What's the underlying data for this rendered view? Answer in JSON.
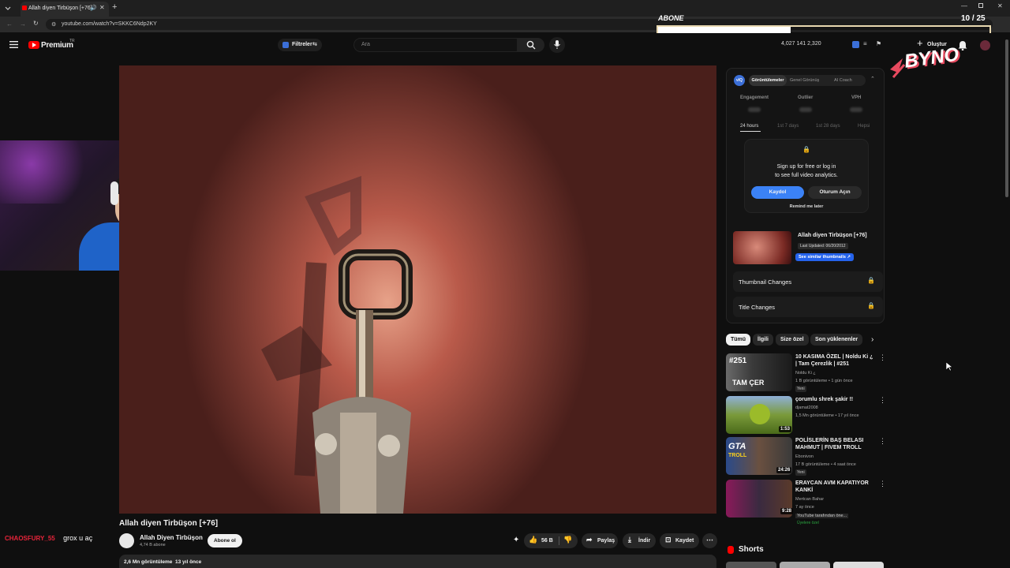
{
  "browser": {
    "tab_title": "Allah diyen Tirbüşon [+76]",
    "url": "youtube.com/watch?v=SKKC6Ndp2KY"
  },
  "overlay": {
    "abone_label": "ABONE",
    "counter": "10 / 25",
    "brand_logo_text": "BYNO"
  },
  "header": {
    "logo_text": "Premium",
    "logo_sup": "TR",
    "filter_label": "Filtreler",
    "search_placeholder": "Ara",
    "stats": "4,027  141  2,320",
    "create_label": "Oluştur"
  },
  "video": {
    "title": "Allah diyen Tirbüşon [+76]",
    "channel_name": "Allah Diyen Tirbüşon",
    "subscribers": "4,74 B abone",
    "subscribe_label": "Abone ol",
    "like_count": "56 B",
    "share_label": "Paylaş",
    "download_label": "İndir",
    "save_label": "Kaydet",
    "views_line": "2,6 Mn görüntüleme  13 yıl önce"
  },
  "chat": {
    "user": "CHAOSFURY_55",
    "message": "grox u aç"
  },
  "analytics": {
    "logo_text": "vIQ",
    "tabs": [
      "Görüntülemeler",
      "Genel Görünüş",
      "AI Coach"
    ],
    "metrics": [
      "Engagement",
      "Outlier",
      "VPH"
    ],
    "ranges": [
      "24 hours",
      "1st 7 days",
      "1st 28 days",
      "Hepsi"
    ],
    "signup_line1": "Sign up for free or log in",
    "signup_line2": "to see full video analytics.",
    "signup_button": "Kaydol",
    "login_button": "Oturum Açın",
    "remind_label": "Remind me later",
    "video_title": "Allah diyen Tirbüşon [+76]",
    "last_updated": "Last Updated: 06/20/2012",
    "similar_button": "See similar thumbnails ↗",
    "thumbnail_changes": "Thumbnail Changes",
    "title_changes": "Title Changes"
  },
  "chips": [
    "Tümü",
    "İlgili",
    "Size özel",
    "Son yüklenenler"
  ],
  "recommendations": [
    {
      "title": "10 KASIMA ÖZEL | Noldu Ki ¿ | Tam Çerezlik | #251",
      "channel": "Noldu Ki ¿",
      "meta": "1 B görüntüleme • 1 gün önce",
      "badge": "Yeni",
      "duration": ""
    },
    {
      "title": "çorumlu shrek şakir !!",
      "channel": "djamat2008",
      "meta": "1,5 Mn görüntüleme • 17 yıl önce",
      "badge": "",
      "duration": "1:53"
    },
    {
      "title": "POLİSLERİN BAŞ BELASI MAHMUT | FIVEM TROLL",
      "channel": "Ebonivon",
      "meta": "17 B görüntüleme • 4 saat önce",
      "badge": "Yeni",
      "duration": "24:26"
    },
    {
      "title": "ERAYCAN AVM KAPATIYOR KANKİ",
      "channel": "Mertcan Bahar",
      "meta": "7 ay önce",
      "meta2": "YouTube tarafından öne...",
      "badge": "Üyelere özel",
      "duration": "9:28"
    }
  ],
  "shorts_label": "Shorts"
}
